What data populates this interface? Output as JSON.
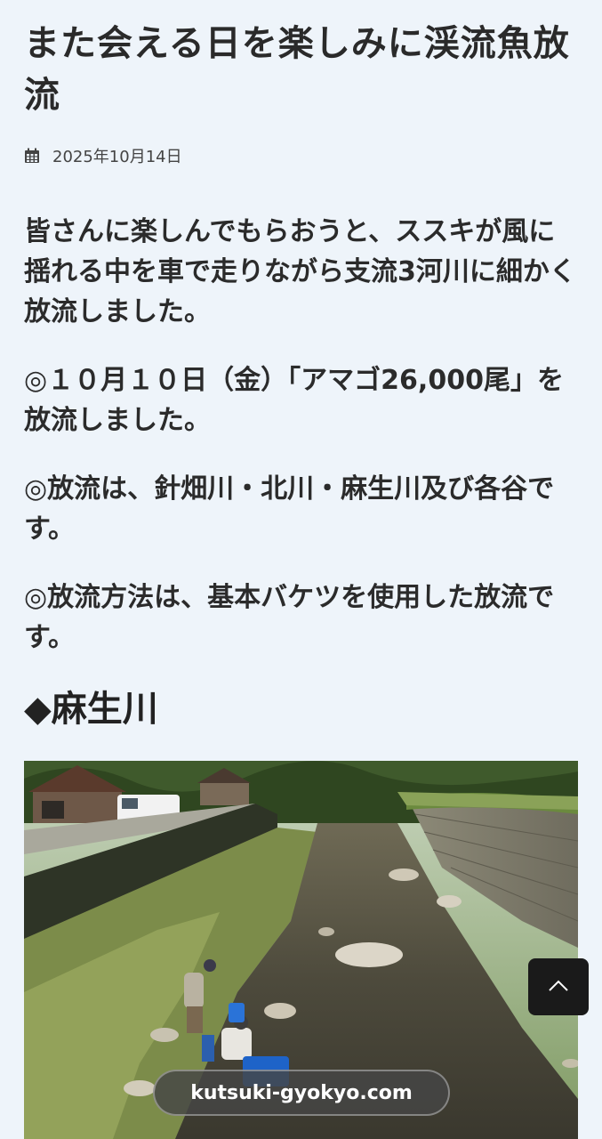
{
  "article": {
    "title": "また会える日を楽しみに渓流魚放流",
    "date": "2025年10月14日",
    "paragraphs": [
      "皆さんに楽しんでもらおうと、ススキが風に揺れる中を車で走りながら支流3河川に細かく放流しました。",
      "◎１０月１０日（金）「アマゴ26,000尾」を放流しました。",
      "◎放流は、針畑川・北川・麻生川及び各谷です。",
      "◎放流方法は、基本バケツを使用した放流です。"
    ],
    "section_heading": "◆麻生川"
  },
  "icons": {
    "date": "calendar-icon",
    "scroll_top": "chevron-up-icon"
  },
  "browser": {
    "url": "kutsuki-gyokyo.com"
  }
}
